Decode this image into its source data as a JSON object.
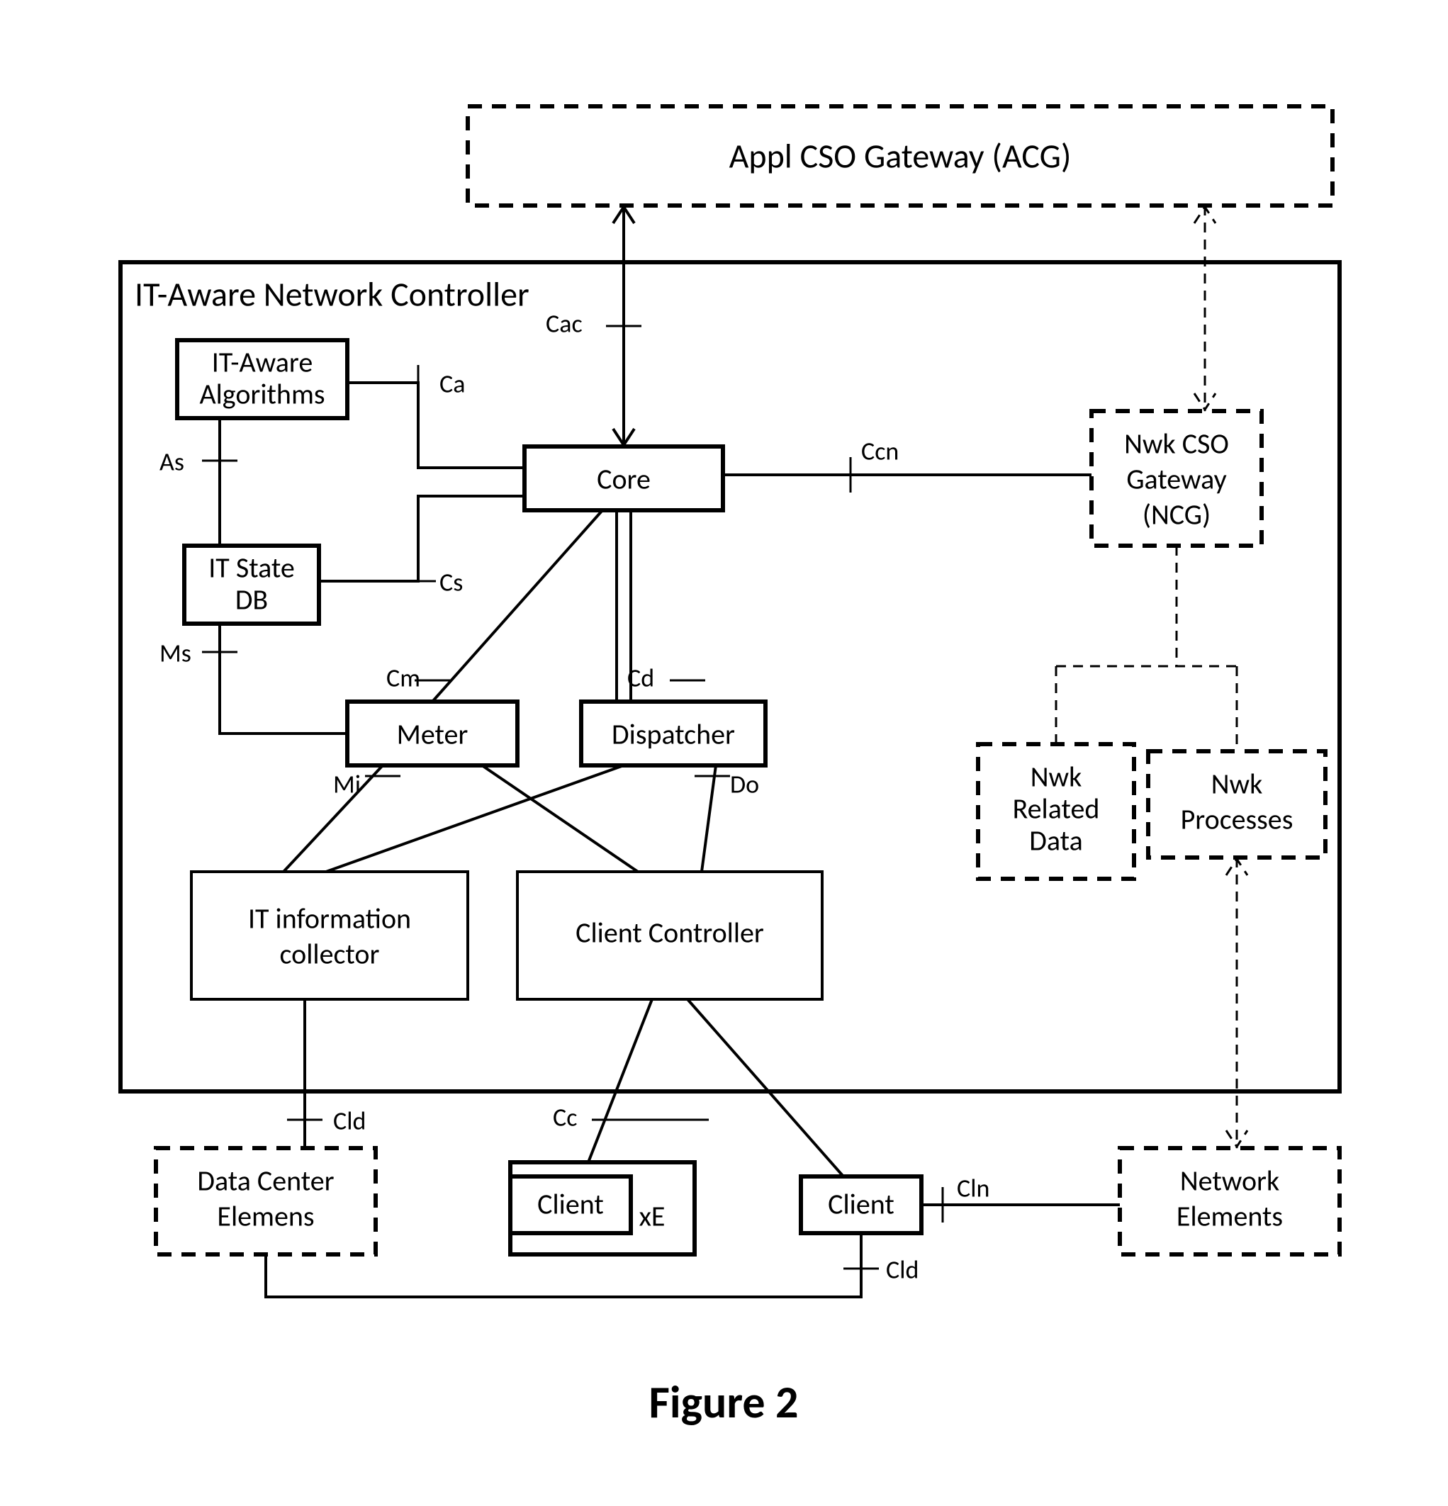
{
  "figure_caption": "Figure 2",
  "container_title": "IT-Aware Network Controller",
  "boxes": {
    "acg": "Appl CSO Gateway (ACG)",
    "it_aware_algorithms_l1": "IT-Aware",
    "it_aware_algorithms_l2": "Algorithms",
    "it_state_db_l1": "IT State",
    "it_state_db_l2": "DB",
    "core": "Core",
    "meter": "Meter",
    "dispatcher": "Dispatcher",
    "ncg_l1": "Nwk CSO",
    "ncg_l2": "Gateway",
    "ncg_l3": "(NCG)",
    "nwk_related_l1": "Nwk",
    "nwk_related_l2": "Related",
    "nwk_related_l3": "Data",
    "nwk_processes_l1": "Nwk",
    "nwk_processes_l2": "Processes",
    "it_info_collector_l1": "IT information",
    "it_info_collector_l2": "collector",
    "client_controller": "Client Controller",
    "data_center_l1": "Data Center",
    "data_center_l2": "Elemens",
    "client1": "Client",
    "xe": "xE",
    "client2": "Client",
    "network_elements_l1": "Network",
    "network_elements_l2": "Elements"
  },
  "edges": {
    "cac": "Cac",
    "ca": "Ca",
    "as": "As",
    "cs": "Cs",
    "ms": "Ms",
    "cm": "Cm",
    "cd": "Cd",
    "ccn": "Ccn",
    "mi": "Mi",
    "do": "Do",
    "cc": "Cc",
    "cld1": "Cld",
    "cln": "Cln",
    "cld2": "Cld"
  }
}
